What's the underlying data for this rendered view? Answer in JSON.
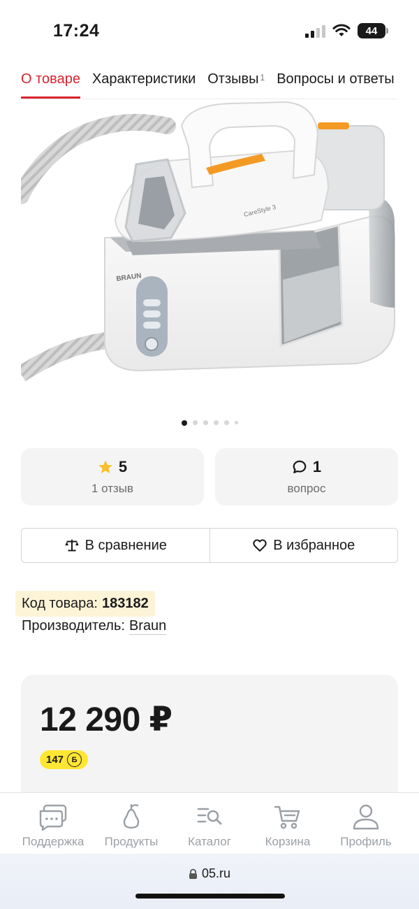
{
  "status_bar": {
    "time": "17:24",
    "battery": "44"
  },
  "tabs": [
    {
      "label": "О товаре",
      "active": true
    },
    {
      "label": "Характеристики"
    },
    {
      "label": "Отзывы",
      "count": "1"
    },
    {
      "label": "Вопросы и ответы"
    }
  ],
  "product_image": {
    "brand_mark": "BRAUN",
    "model_mark": "CareStyle 3",
    "panel_buttons": [
      "turbo",
      "mode",
      "clean"
    ],
    "dots_count": 6,
    "active_dot": 0
  },
  "rating_card": {
    "value": "5",
    "sub": "1 отзыв",
    "icon": "star-icon"
  },
  "questions_card": {
    "value": "1",
    "sub": "вопрос",
    "icon": "speech-bubble-icon"
  },
  "actions": {
    "compare_label": "В сравнение",
    "favorite_label": "В избранное"
  },
  "product_info": {
    "code_label": "Код товара:",
    "code_value": "183182",
    "maker_label": "Производитель:",
    "maker_value": "Braun"
  },
  "price": {
    "value": "12 290 ₽",
    "bonus": "147",
    "bonus_icon_letter": "Б"
  },
  "bottom_nav": [
    {
      "label": "Поддержка",
      "icon": "chat-icon"
    },
    {
      "label": "Продукты",
      "icon": "pear-icon"
    },
    {
      "label": "Каталог",
      "icon": "catalog-search-icon"
    },
    {
      "label": "Корзина",
      "icon": "cart-icon"
    },
    {
      "label": "Профиль",
      "icon": "profile-icon"
    }
  ],
  "browser": {
    "url": "05.ru"
  },
  "colors": {
    "accent": "#d9232e",
    "star": "#f5c02c",
    "bonus_badge": "#ffe633",
    "iron_orange": "#f39a24",
    "nav_gray": "#9aa0a6"
  }
}
